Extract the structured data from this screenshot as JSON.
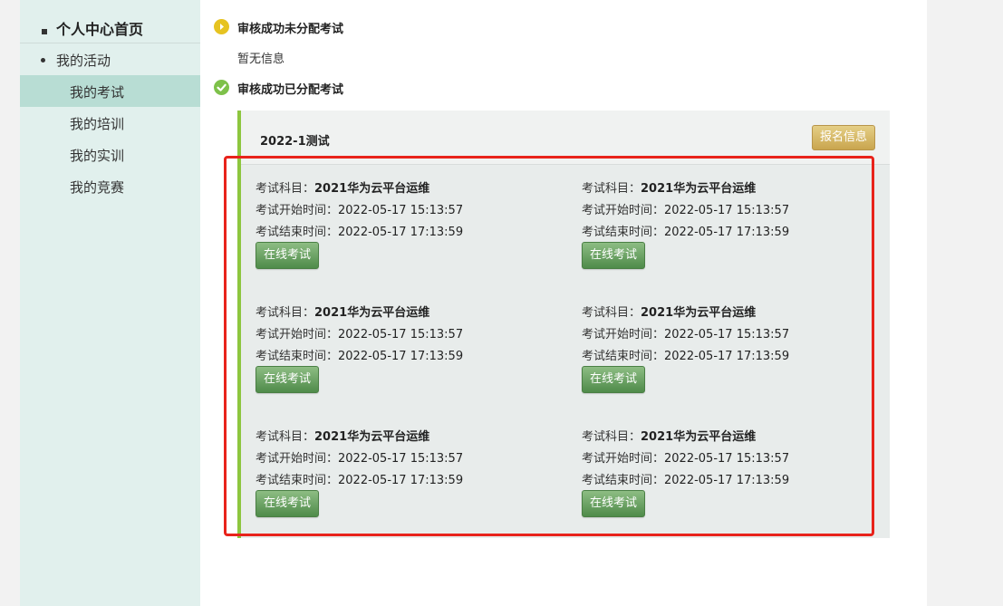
{
  "sidebar": {
    "home_label": "个人中心首页",
    "group_label": "我的活动",
    "items": [
      {
        "label": "我的考试",
        "active": true
      },
      {
        "label": "我的培训",
        "active": false
      },
      {
        "label": "我的实训",
        "active": false
      },
      {
        "label": "我的竞赛",
        "active": false
      }
    ]
  },
  "status": {
    "unassigned_title": "审核成功未分配考试",
    "unassigned_empty": "暂无信息",
    "assigned_title": "审核成功已分配考试"
  },
  "panel": {
    "title": "2022-1测试",
    "signup_button": "报名信息",
    "subject_label": "考试科目：",
    "start_label": "考试开始时间：",
    "end_label": "考试结束时间：",
    "exam_button": "在线考试",
    "exams": [
      {
        "subject": "2021华为云平台运维",
        "start": "2022-05-17 15:13:57",
        "end": "2022-05-17 17:13:59"
      },
      {
        "subject": "2021华为云平台运维",
        "start": "2022-05-17 15:13:57",
        "end": "2022-05-17 17:13:59"
      },
      {
        "subject": "2021华为云平台运维",
        "start": "2022-05-17 15:13:57",
        "end": "2022-05-17 17:13:59"
      },
      {
        "subject": "2021华为云平台运维",
        "start": "2022-05-17 15:13:57",
        "end": "2022-05-17 17:13:59"
      },
      {
        "subject": "2021华为云平台运维",
        "start": "2022-05-17 15:13:57",
        "end": "2022-05-17 17:13:59"
      },
      {
        "subject": "2021华为云平台运维",
        "start": "2022-05-17 15:13:57",
        "end": "2022-05-17 17:13:59"
      }
    ]
  },
  "colors": {
    "highlight": "#e8231b",
    "sidebar_bg": "#e1f0ed",
    "active_item": "#b8ddd4",
    "exam_button": "#5f9a58",
    "signup_button": "#d4b563"
  }
}
